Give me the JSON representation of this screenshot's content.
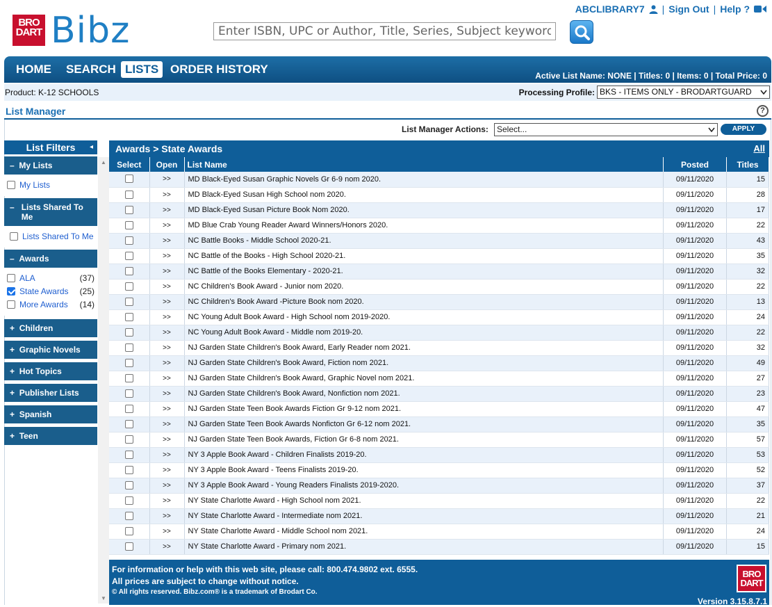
{
  "brand": {
    "logo_text": "Bibz",
    "logo_box": "BRO DART"
  },
  "search": {
    "placeholder": "Enter ISBN, UPC or Author, Title, Series, Subject keywords"
  },
  "top_links": {
    "user": "ABCLIBRARY7",
    "sign_out": "Sign Out",
    "help": "Help ?",
    "separator": "|"
  },
  "nav": {
    "home": "HOME",
    "search": "SEARCH",
    "lists": "LISTS",
    "order_history": "ORDER HISTORY"
  },
  "active_list": "Active List Name: NONE  | Titles: 0 | Items: 0 | Total Price: 0",
  "product": "Product: K-12 SCHOOLS",
  "processing_profile": {
    "label": "Processing Profile:",
    "value": "BKS - ITEMS ONLY - BRODARTGUARD"
  },
  "list_manager": {
    "title": "List Manager",
    "help": "?",
    "actions_label": "List Manager Actions:",
    "actions_value": "Select...",
    "apply": "APPLY"
  },
  "sidebar": {
    "title": "List Filters",
    "collapse": "◂",
    "my_lists": {
      "head": "My Lists",
      "sign": "–",
      "item": "My Lists"
    },
    "shared": {
      "head": "Lists Shared To Me",
      "sign": "–",
      "item": "Lists Shared To Me"
    },
    "awards": {
      "head": "Awards",
      "sign": "–",
      "items": [
        {
          "label": "ALA",
          "count": "(37)",
          "checked": false
        },
        {
          "label": "State Awards",
          "count": "(25)",
          "checked": true
        },
        {
          "label": "More Awards",
          "count": "(14)",
          "checked": false
        }
      ]
    },
    "collapsed": [
      "Children",
      "Graphic Novels",
      "Hot Topics",
      "Publisher Lists",
      "Spanish",
      "Teen"
    ],
    "collapsed_sign": "+"
  },
  "main": {
    "breadcrumb": "Awards > State Awards",
    "all_link": "All",
    "columns": {
      "select": "Select",
      "open": "Open",
      "name": "List Name",
      "posted": "Posted",
      "titles": "Titles"
    },
    "rows": [
      {
        "open": ">>",
        "name": "MD Black-Eyed Susan Graphic Novels Gr 6-9 nom 2020.",
        "posted": "09/11/2020",
        "titles": "15"
      },
      {
        "open": ">>",
        "name": "MD Black-Eyed Susan High School nom 2020.",
        "posted": "09/11/2020",
        "titles": "28"
      },
      {
        "open": ">>",
        "name": "MD Black-Eyed Susan Picture Book Nom 2020.",
        "posted": "09/11/2020",
        "titles": "17"
      },
      {
        "open": ">>",
        "name": "MD Blue Crab Young Reader Award Winners/Honors 2020.",
        "posted": "09/11/2020",
        "titles": "22"
      },
      {
        "open": ">>",
        "name": "NC Battle Books - Middle School 2020-21.",
        "posted": "09/11/2020",
        "titles": "43"
      },
      {
        "open": ">>",
        "name": "NC Battle of the Books - High School 2020-21.",
        "posted": "09/11/2020",
        "titles": "35"
      },
      {
        "open": ">>",
        "name": "NC Battle of the Books Elementary - 2020-21.",
        "posted": "09/11/2020",
        "titles": "32"
      },
      {
        "open": ">>",
        "name": "NC Children's Book Award - Junior nom 2020.",
        "posted": "09/11/2020",
        "titles": "22"
      },
      {
        "open": ">>",
        "name": "NC Children's Book Award -Picture Book nom 2020.",
        "posted": "09/11/2020",
        "titles": "13"
      },
      {
        "open": ">>",
        "name": "NC Young Adult Book Award - High School nom 2019-2020.",
        "posted": "09/11/2020",
        "titles": "24"
      },
      {
        "open": ">>",
        "name": "NC Young Adult Book Award - Middle nom 2019-20.",
        "posted": "09/11/2020",
        "titles": "22"
      },
      {
        "open": ">>",
        "name": "NJ Garden State Children's Book Award, Early Reader nom 2021.",
        "posted": "09/11/2020",
        "titles": "32"
      },
      {
        "open": ">>",
        "name": "NJ Garden State Children's Book Award, Fiction nom 2021.",
        "posted": "09/11/2020",
        "titles": "49"
      },
      {
        "open": ">>",
        "name": "NJ Garden State Children's Book Award, Graphic Novel nom 2021.",
        "posted": "09/11/2020",
        "titles": "27"
      },
      {
        "open": ">>",
        "name": "NJ Garden State Children's Book Award, Nonfiction nom 2021.",
        "posted": "09/11/2020",
        "titles": "23"
      },
      {
        "open": ">>",
        "name": "NJ Garden State Teen Book Awards Fiction Gr 9-12 nom 2021.",
        "posted": "09/11/2020",
        "titles": "47"
      },
      {
        "open": ">>",
        "name": "NJ Garden State Teen Book Awards Nonficton Gr 6-12 nom 2021.",
        "posted": "09/11/2020",
        "titles": "35"
      },
      {
        "open": ">>",
        "name": "NJ Garden State Teen Book Awards, Fiction Gr 6-8 nom 2021.",
        "posted": "09/11/2020",
        "titles": "57"
      },
      {
        "open": ">>",
        "name": "NY 3 Apple Book Award - Children Finalists 2019-20.",
        "posted": "09/11/2020",
        "titles": "53"
      },
      {
        "open": ">>",
        "name": "NY 3 Apple Book Award - Teens Finalists 2019-20.",
        "posted": "09/11/2020",
        "titles": "52"
      },
      {
        "open": ">>",
        "name": "NY 3 Apple Book Award - Young Readers Finalists 2019-2020.",
        "posted": "09/11/2020",
        "titles": "37"
      },
      {
        "open": ">>",
        "name": "NY State Charlotte Award - High School nom 2021.",
        "posted": "09/11/2020",
        "titles": "22"
      },
      {
        "open": ">>",
        "name": "NY State Charlotte Award - Intermediate nom 2021.",
        "posted": "09/11/2020",
        "titles": "21"
      },
      {
        "open": ">>",
        "name": "NY State Charlotte Award - Middle School nom 2021.",
        "posted": "09/11/2020",
        "titles": "24"
      },
      {
        "open": ">>",
        "name": "NY State Charlotte Award - Primary nom 2021.",
        "posted": "09/11/2020",
        "titles": "15"
      }
    ]
  },
  "footer": {
    "line1": "For information or help with this web site, please call: 800.474.9802 ext. 6555.",
    "line2": "All prices are subject to change without notice.",
    "line3": "© All rights reserved. Bibz.com® is a trademark of Brodart Co.",
    "logo": "BRO DART",
    "version": "Version 3.15.8.7.1"
  },
  "colors": {
    "primary": "#0f5e99",
    "link": "#1f5fd0",
    "brand_red": "#c8102e",
    "row_alt": "#e9f1fa"
  }
}
